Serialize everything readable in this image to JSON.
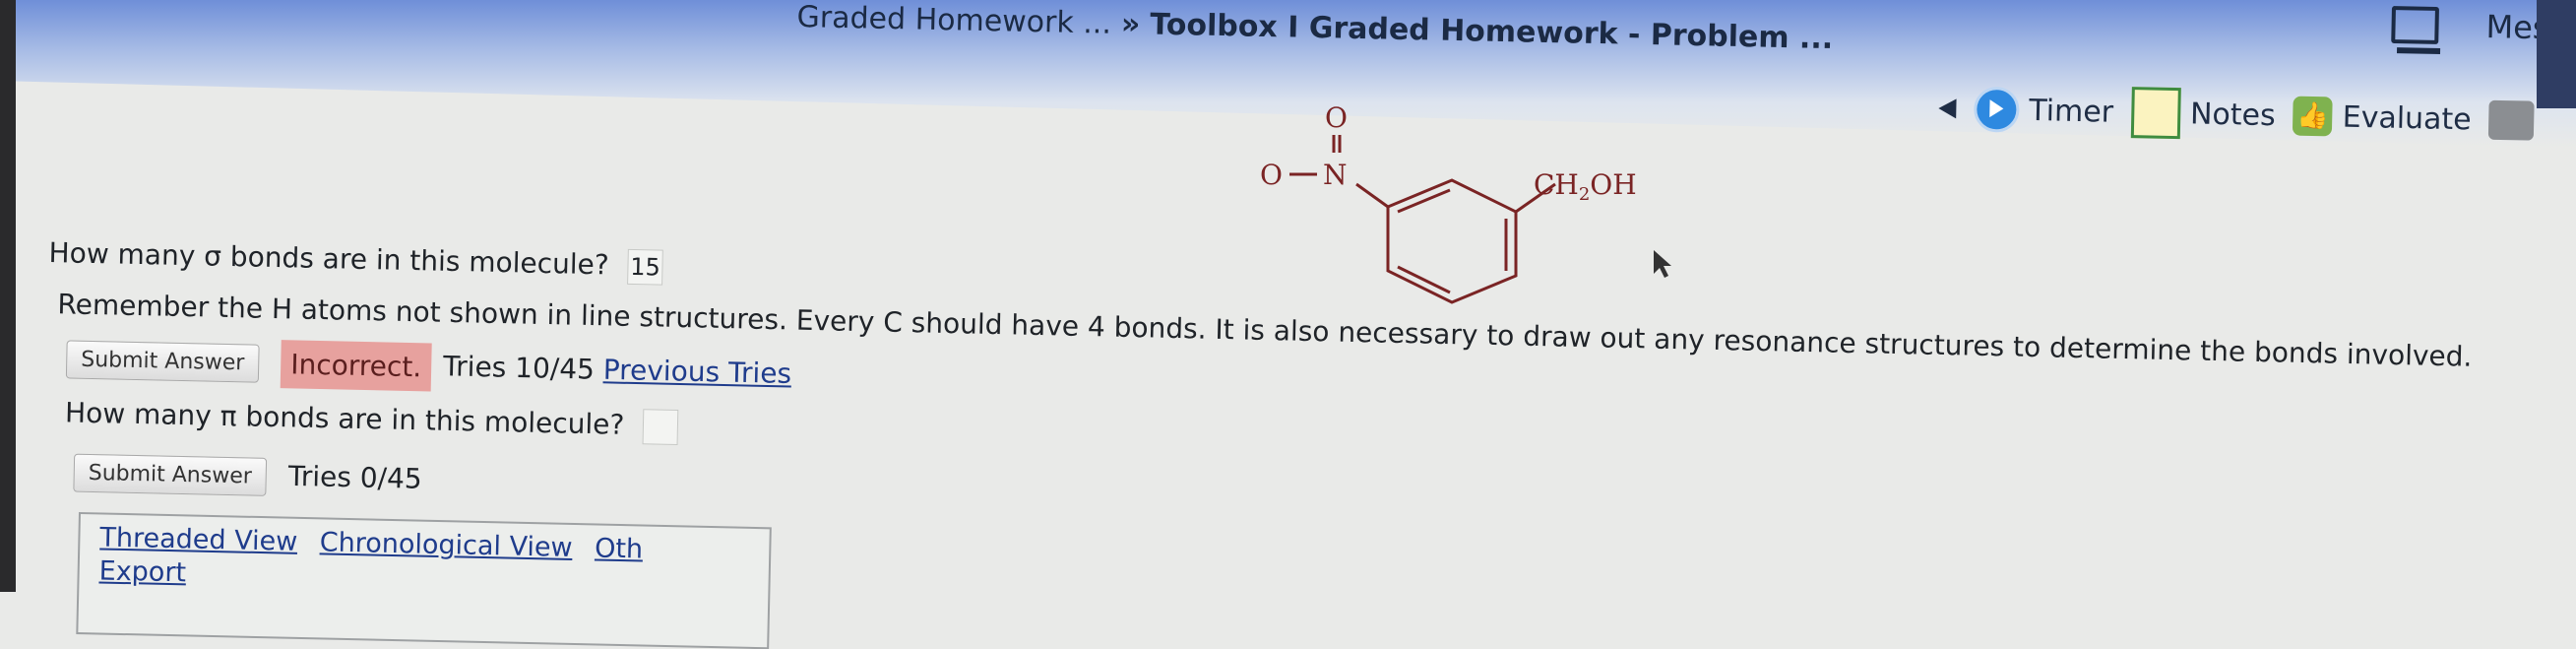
{
  "header": {
    "breadcrumb_prev": "Graded Homework ...",
    "breadcrumb_sep": "»",
    "breadcrumb_current": "Toolbox I Graded Homework - Problem ...",
    "timer_label": "Timer",
    "notes_label": "Notes",
    "evaluate_label": "Evaluate",
    "messages_label": "Messa"
  },
  "molecule": {
    "oxygen_top": "O",
    "double_bond": "||",
    "oxygen_left": "O",
    "nitrogen": "N",
    "substituent": "CH",
    "substituent_sub": "2",
    "substituent_end": "OH"
  },
  "question1": {
    "text": "How many σ bonds are in this molecule?",
    "answer": "15",
    "hint": "Remember the H atoms not shown in line structures. Every C should have 4 bonds. It is also necessary to draw out any resonance structures to determine the bonds involved.",
    "submit_label": "Submit Answer",
    "status": "Incorrect.",
    "tries": "Tries 10/45",
    "previous_tries": "Previous Tries"
  },
  "question2": {
    "text": "How many π bonds are in this molecule?",
    "answer": "",
    "submit_label": "Submit Answer",
    "tries": "Tries 0/45"
  },
  "discussion": {
    "threaded_view": "Threaded View",
    "chronological_view": "Chronological View",
    "other": "Oth",
    "export": "Export"
  },
  "colors": {
    "header_blue": "#6f8fd8",
    "incorrect_bg": "#e7a19e",
    "link": "#1f3c8c",
    "molecule": "#7a2424"
  },
  "icons": [
    "back-triangle-icon",
    "timer-icon",
    "notes-icon",
    "evaluate-thumb-icon",
    "computer-icon"
  ]
}
